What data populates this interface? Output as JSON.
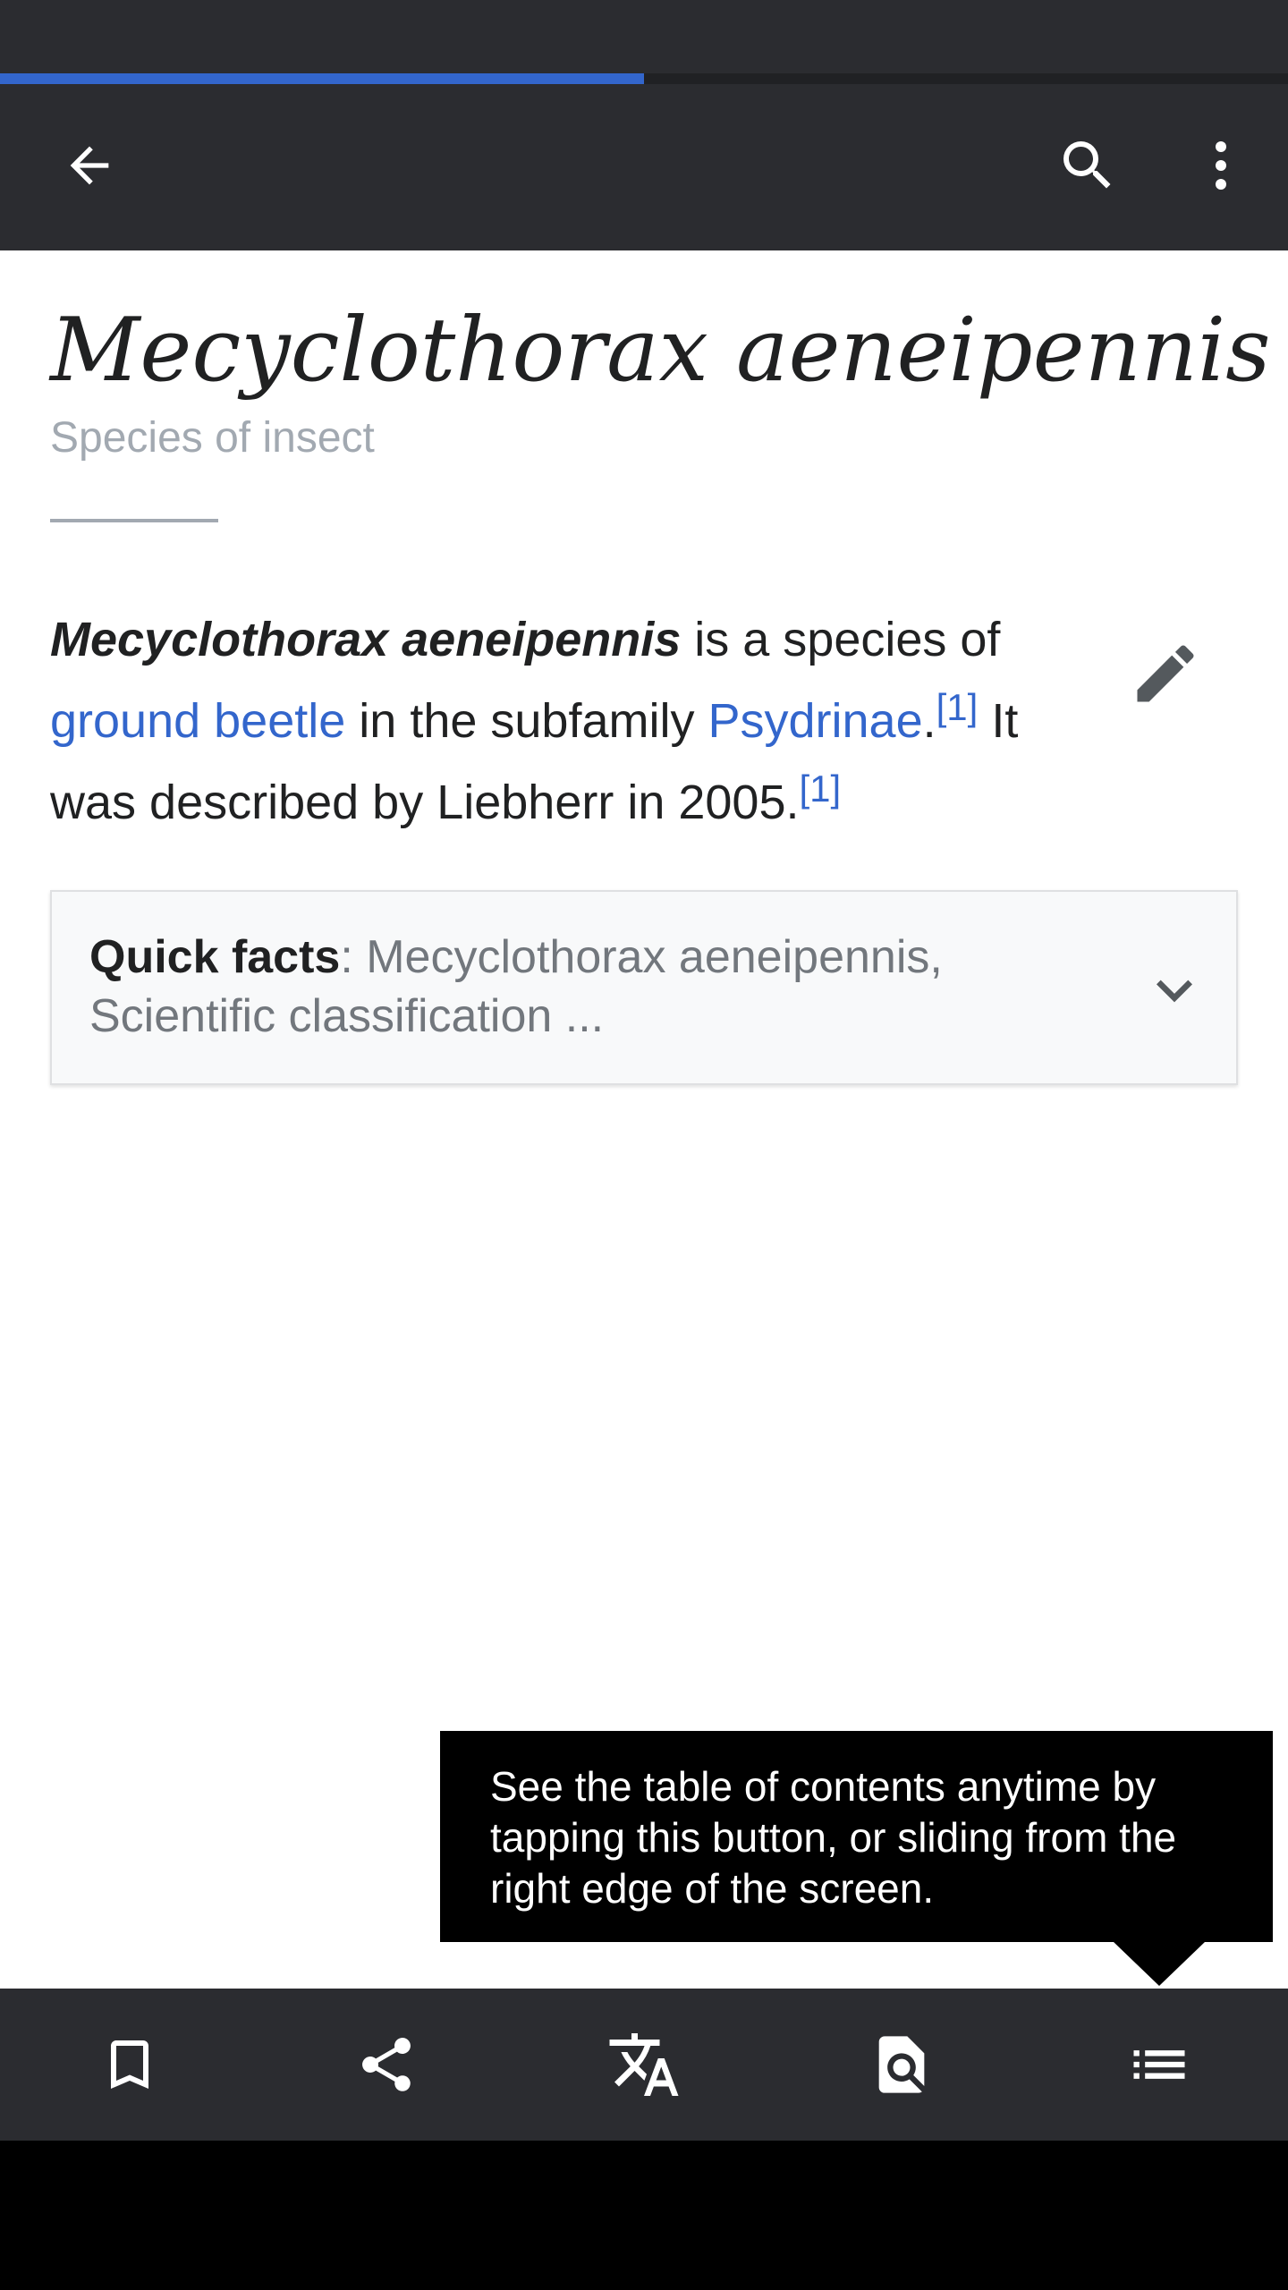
{
  "colors": {
    "chrome": "#2b2c30",
    "progress": "#3366cc",
    "link": "#3366cc",
    "text": "#202122",
    "muted": "#a2a9b1",
    "tooltip_bg": "#000000"
  },
  "page_progress": 0.5,
  "appbar": {
    "back_icon": "arrow-back-icon",
    "search_icon": "search-icon",
    "more_icon": "more-vertical-icon"
  },
  "article": {
    "title": "Mecyclothorax aeneipennis",
    "subtitle": "Species of insect",
    "lead": {
      "bold_name": "Mecyclothorax aeneipennis",
      "text1": " is a species of ",
      "link1": "ground beetle",
      "text2": " in the subfamily ",
      "link2": "Psydrinae",
      "text3": ".",
      "ref1": "[1]",
      "text4": " It was described by Liebherr in 2005.",
      "ref2": "[1]"
    },
    "edit_icon": "pencil-edit-icon"
  },
  "quick_facts": {
    "label": "Quick facts",
    "text": ": Mecyclothorax aeneipennis, Scientific classification ...",
    "expand_icon": "chevron-down-icon"
  },
  "tooltip": {
    "text": "See the table of contents anytime by tapping this button, or sliding from the right edge of the screen."
  },
  "toolbar": {
    "items": [
      {
        "name": "bookmark",
        "icon": "bookmark-icon"
      },
      {
        "name": "share",
        "icon": "share-icon"
      },
      {
        "name": "language",
        "icon": "translate-icon"
      },
      {
        "name": "find-in-page",
        "icon": "find-in-page-icon"
      },
      {
        "name": "contents",
        "icon": "table-of-contents-icon"
      }
    ]
  }
}
